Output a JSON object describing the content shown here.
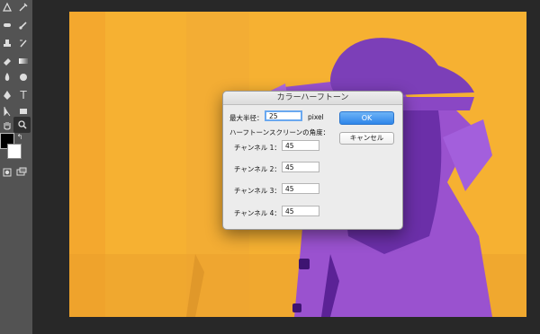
{
  "dialog": {
    "title": "カラーハーフトーン",
    "max_radius_label": "最大半径：",
    "max_radius_value": "25",
    "unit": "pixel",
    "screen_angle_label": "ハーフトーンスクリーンの角度：",
    "channels": [
      {
        "label": "チャンネル 1：",
        "value": "45"
      },
      {
        "label": "チャンネル 2：",
        "value": "45"
      },
      {
        "label": "チャンネル 3：",
        "value": "45"
      },
      {
        "label": "チャンネル 4：",
        "value": "45"
      }
    ],
    "ok_label": "OK",
    "cancel_label": "キャンセル"
  },
  "toolbar": {
    "tools": [
      "move-icon",
      "eyedropper-icon",
      "healing-brush-icon",
      "brush-icon",
      "clone-stamp-icon",
      "history-brush-icon",
      "eraser-icon",
      "gradient-icon",
      "blur-icon",
      "dodge-icon",
      "pen-icon",
      "type-icon",
      "path-selection-icon",
      "rectangle-icon",
      "hand-icon",
      "zoom-icon"
    ],
    "type_tool_glyph": "T",
    "foreground_color": "#000000",
    "background_color": "#ffffff"
  },
  "colors": {
    "photo_orange": "#f6b132",
    "photo_purple": "#9a4fd0",
    "ok_blue": "#2f86ea"
  }
}
